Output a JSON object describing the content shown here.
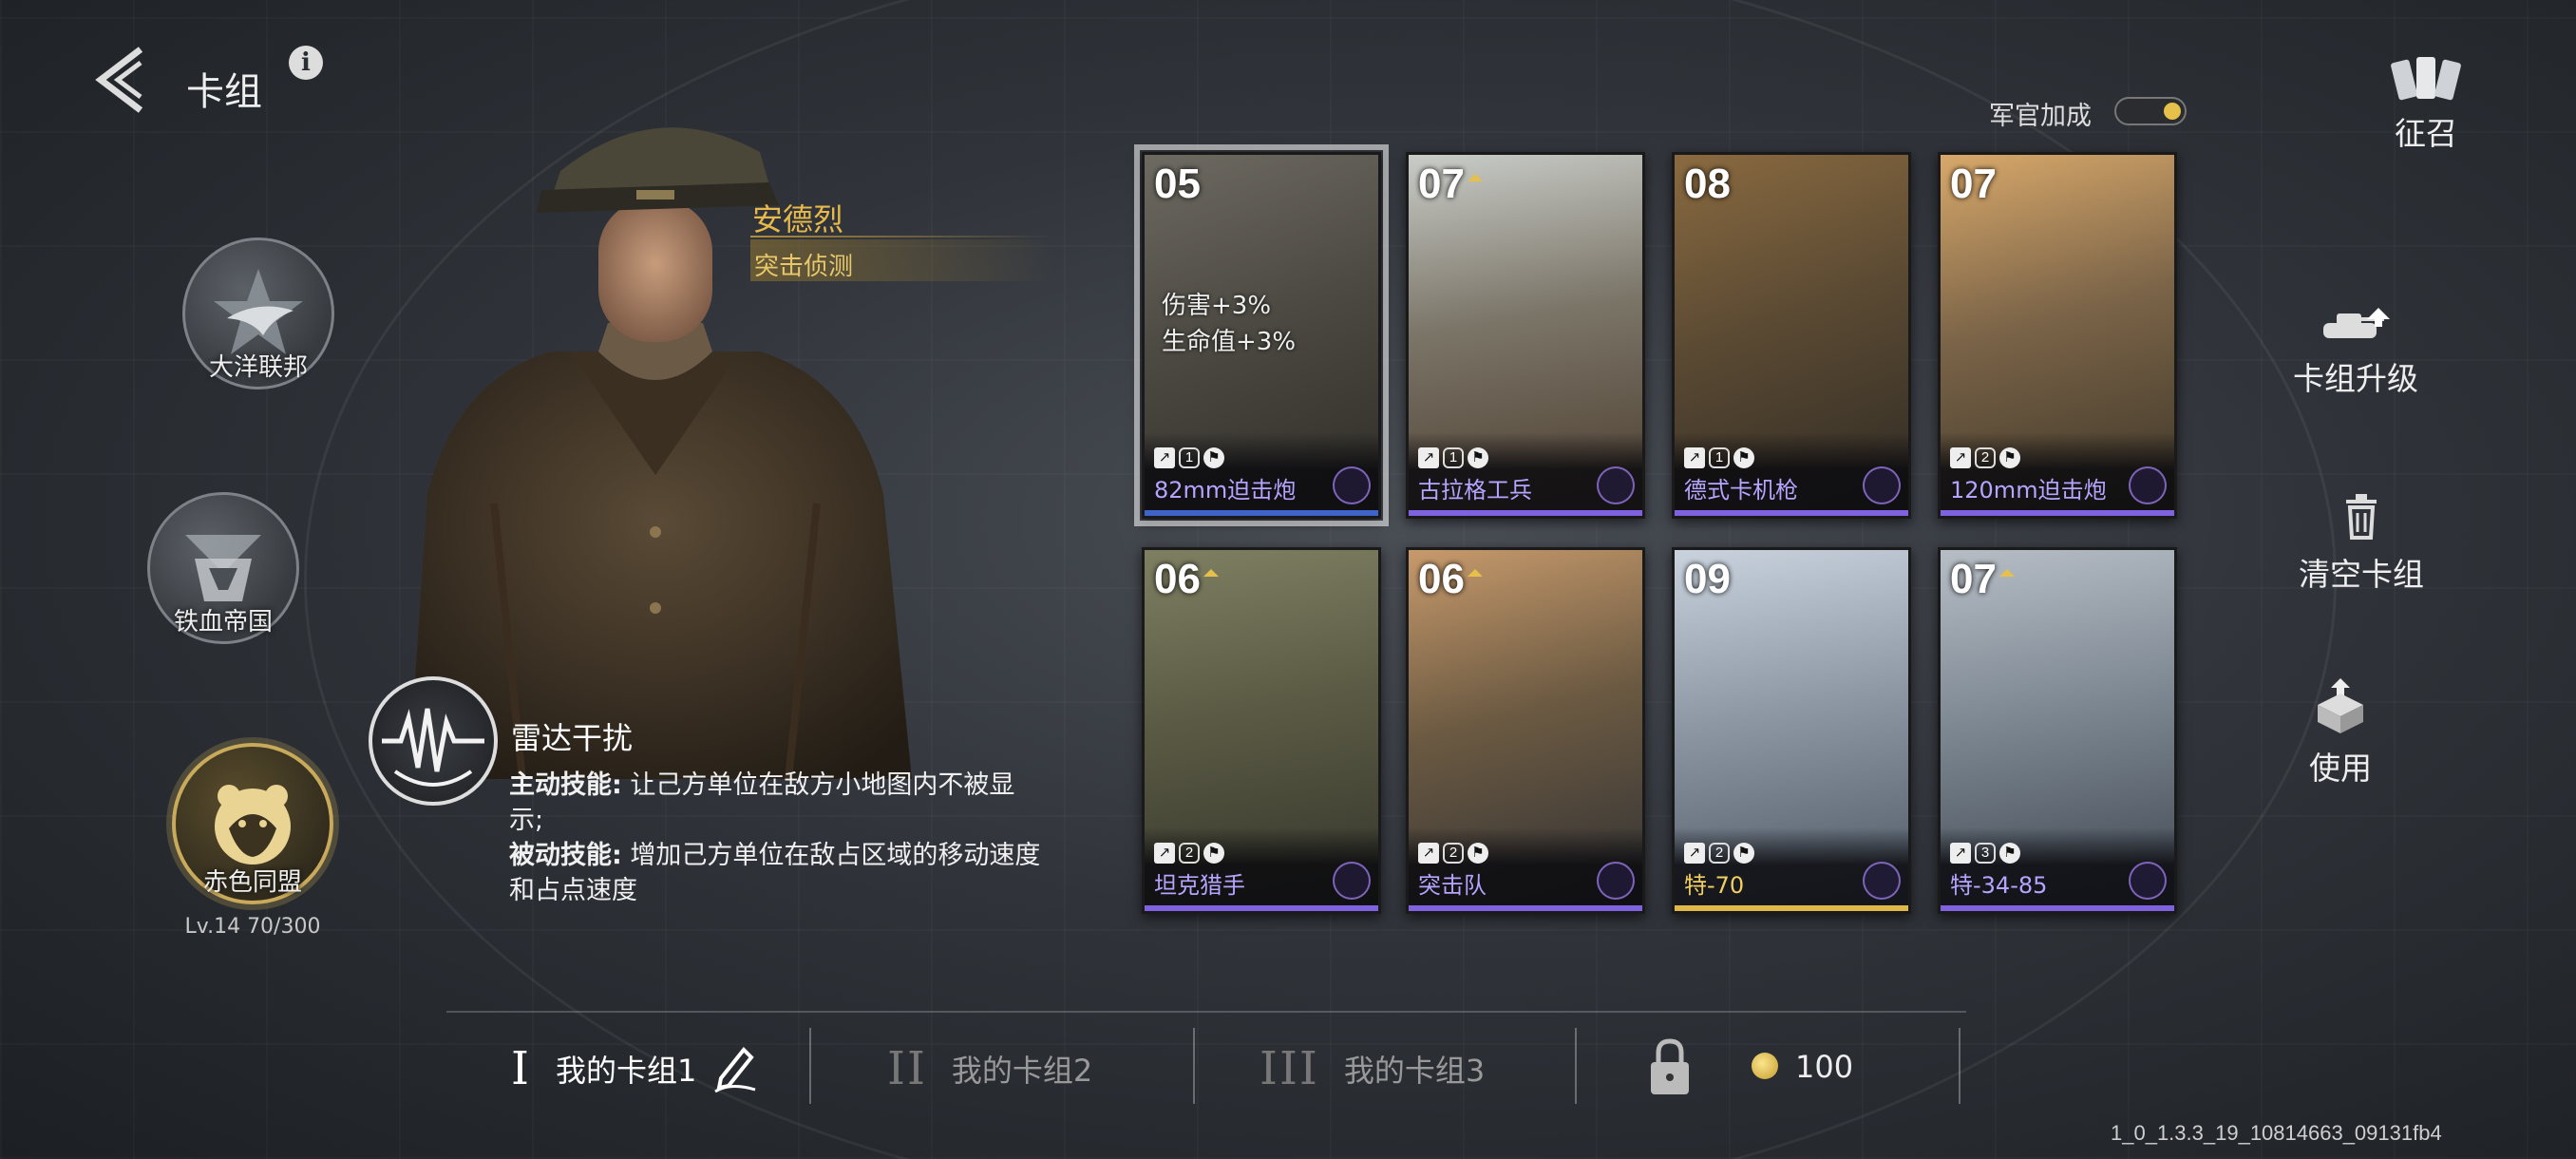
{
  "header": {
    "title": "卡组",
    "info_label": "i"
  },
  "factions": [
    {
      "name": "大洋联邦"
    },
    {
      "name": "铁血帝国"
    },
    {
      "name": "赤色同盟",
      "level": "Lv.14  70/300",
      "active": true
    }
  ],
  "commander": {
    "name": "安德烈",
    "role": "突击侦测",
    "skill": {
      "name": "雷达干扰",
      "active_label": "主动技能:",
      "active_text": "让己方单位在敌方小地图内不被显示;",
      "passive_label": "被动技能:",
      "passive_text": "增加己方单位在敌占区域的移动速度和占点速度"
    }
  },
  "officer_bonus": {
    "label": "军官加成",
    "enabled": true
  },
  "cards": [
    {
      "cost": "05",
      "name": "82mm迫击炮",
      "rank": false,
      "stat_num": "1",
      "buff1": "伤害+3%",
      "buff2": "生命值+3%",
      "stripe": "blue"
    },
    {
      "cost": "07",
      "name": "古拉格工兵",
      "rank": true,
      "stat_num": "1",
      "stripe": "purple"
    },
    {
      "cost": "08",
      "name": "德式卡机枪",
      "rank": false,
      "stat_num": "1",
      "stripe": "purple"
    },
    {
      "cost": "07",
      "name": "120mm迫击炮",
      "rank": false,
      "stat_num": "2",
      "stripe": "purple"
    },
    {
      "cost": "06",
      "name": "坦克猎手",
      "rank": true,
      "stat_num": "2",
      "stripe": "purple"
    },
    {
      "cost": "06",
      "name": "突击队",
      "rank": true,
      "stat_num": "2",
      "stripe": "purple"
    },
    {
      "cost": "09",
      "name": "特-70",
      "rank": false,
      "stat_num": "2",
      "stripe": "gold"
    },
    {
      "cost": "07",
      "name": "特-34-85",
      "rank": true,
      "stat_num": "3",
      "stripe": "purple"
    }
  ],
  "actions": {
    "recruit": "征召",
    "upgrade": "卡组升级",
    "clear": "清空卡组",
    "use": "使用"
  },
  "tabs": [
    {
      "roman": "I",
      "label": "我的卡组1",
      "active": true
    },
    {
      "roman": "II",
      "label": "我的卡组2"
    },
    {
      "roman": "III",
      "label": "我的卡组3"
    }
  ],
  "unlock_cost": "100",
  "version": "1_0_1.3.3_19_10814663_09131fb4",
  "colors": {
    "gold": "#e7b94b",
    "purple": "#7f62e0",
    "blue": "#3f63c8"
  }
}
